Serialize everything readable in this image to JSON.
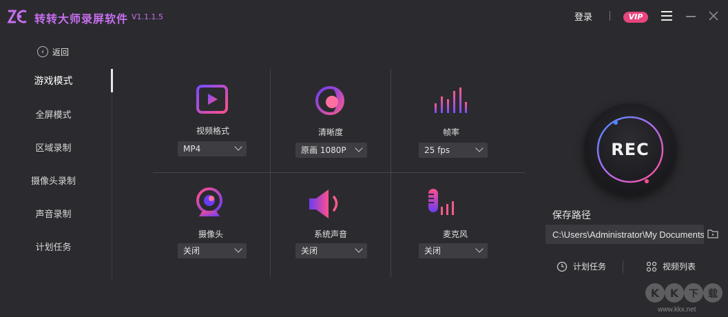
{
  "app": {
    "title": "转转大师录屏软件",
    "version": "V1.1.1.5",
    "logo_text": "ZC"
  },
  "header": {
    "login": "登录",
    "vip": "VIP"
  },
  "sidebar": {
    "back_label": "返回",
    "items": [
      {
        "label": "游戏模式",
        "active": true
      },
      {
        "label": "全屏模式"
      },
      {
        "label": "区域录制"
      },
      {
        "label": "摄像头录制"
      },
      {
        "label": "声音录制"
      },
      {
        "label": "计划任务"
      }
    ]
  },
  "settings": {
    "video_format": {
      "label": "视频格式",
      "value": "MP4",
      "icon": "play-video-icon"
    },
    "clarity": {
      "label": "清晰度",
      "value": "原画 1080P",
      "icon": "clarity-icon"
    },
    "frame_rate": {
      "label": "帧率",
      "value": "25 fps",
      "icon": "equalizer-icon"
    },
    "camera": {
      "label": "摄像头",
      "value": "关闭",
      "icon": "webcam-icon"
    },
    "system_audio": {
      "label": "系统声音",
      "value": "关闭",
      "icon": "speaker-icon"
    },
    "microphone": {
      "label": "麦克风",
      "value": "关闭",
      "icon": "microphone-icon"
    }
  },
  "record": {
    "label": "REC"
  },
  "save": {
    "label": "保存路径",
    "path": "C:\\Users\\Administrator\\My Documents"
  },
  "links": {
    "schedule": "计划任务",
    "video_list": "视频列表"
  },
  "watermark": {
    "text": "KK下载",
    "url": "www.kkx.net"
  },
  "colors": {
    "accent": "#c86ff0",
    "vip": "#e8457e",
    "background": "#2b2b2f"
  }
}
